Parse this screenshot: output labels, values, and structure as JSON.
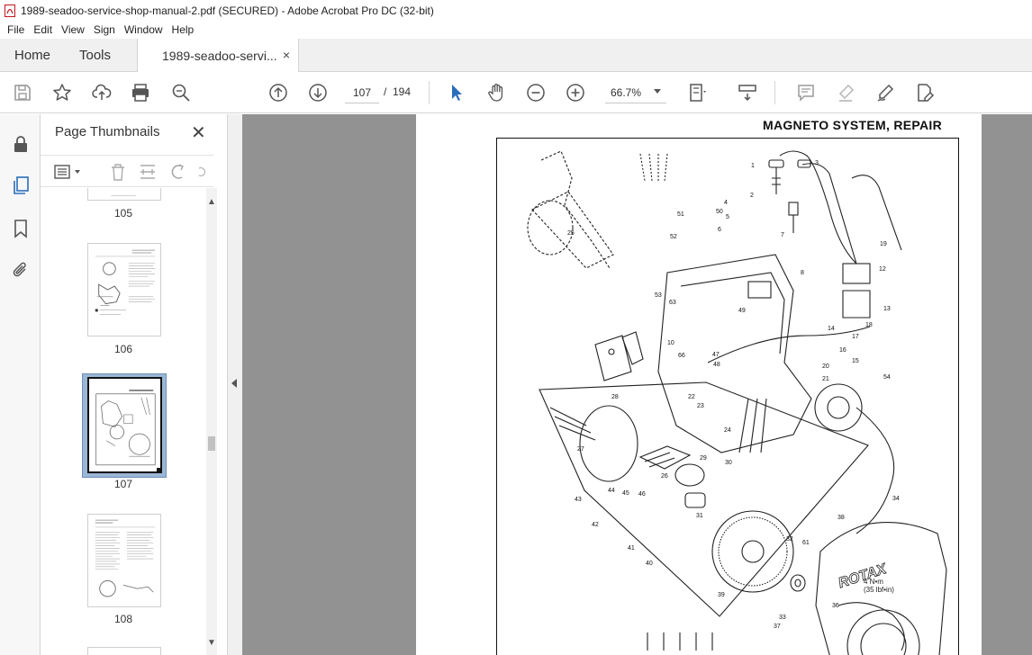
{
  "window": {
    "title": "1989-seadoo-service-shop-manual-2.pdf (SECURED) - Adobe Acrobat Pro DC (32-bit)"
  },
  "menu": [
    "File",
    "Edit",
    "View",
    "Sign",
    "Window",
    "Help"
  ],
  "tabs": {
    "home": "Home",
    "tools": "Tools",
    "document": "1989-seadoo-servi...",
    "close_symbol": "×"
  },
  "toolbar": {
    "current_page": "107",
    "separator": "/",
    "total_pages": "194",
    "zoom": "66.7%"
  },
  "thumbnails": {
    "title": "Page Thumbnails",
    "close_symbol": "✕",
    "pages": [
      "105",
      "106",
      "107",
      "108"
    ],
    "selected_page": "107"
  },
  "document": {
    "heading": "MAGNETO SYSTEM, REPAIR",
    "torque_label": "4 N•m\n(35 lbf•in)",
    "brand_label": "ROTAX",
    "callouts": [
      "1",
      "2",
      "3",
      "4",
      "5",
      "6",
      "7",
      "8",
      "10",
      "12",
      "13",
      "14",
      "15",
      "16",
      "17",
      "18",
      "19",
      "20",
      "21",
      "22",
      "23",
      "24",
      "25",
      "26",
      "27",
      "28",
      "29",
      "30",
      "31",
      "32",
      "33",
      "34",
      "36",
      "37",
      "38",
      "39",
      "40",
      "41",
      "42",
      "43",
      "44",
      "45",
      "46",
      "47",
      "48",
      "49",
      "50",
      "51",
      "52",
      "53",
      "54",
      "61",
      "63",
      "66"
    ]
  },
  "colors": {
    "accent_blue": "#2a6ebb",
    "doc_background": "#929292",
    "selected_thumb": "#9ab6d6"
  }
}
